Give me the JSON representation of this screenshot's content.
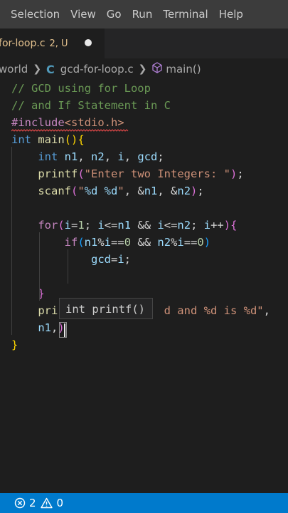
{
  "menu": [
    "Selection",
    "View",
    "Go",
    "Run",
    "Terminal",
    "Help"
  ],
  "tab": {
    "title": "-for-loop.c",
    "status": "2, U"
  },
  "breadcrumb": {
    "folder": "world",
    "file_icon": "C",
    "file": "gcd-for-loop.c",
    "symbol": "main()"
  },
  "code": [
    [
      [
        "// GCD using for Loop",
        "c-cmt"
      ]
    ],
    [
      [
        "// and If Statement in C",
        "c-cmt"
      ]
    ],
    [
      [
        "#include",
        "c-inc"
      ],
      [
        "<stdio.h>",
        "c-str"
      ]
    ],
    [
      [
        "int",
        "c-kw"
      ],
      [
        " ",
        ""
      ],
      [
        "main",
        "c-fn"
      ],
      [
        "(){",
        "c-br1"
      ]
    ],
    [
      [
        "    ",
        ""
      ],
      [
        "int",
        "c-kw"
      ],
      [
        " ",
        ""
      ],
      [
        "n1",
        "c-var"
      ],
      [
        ", ",
        ""
      ],
      [
        "n2",
        "c-var"
      ],
      [
        ", ",
        ""
      ],
      [
        "i",
        "c-var"
      ],
      [
        ", ",
        ""
      ],
      [
        "gcd",
        "c-var"
      ],
      [
        ";",
        ""
      ]
    ],
    [
      [
        "    ",
        ""
      ],
      [
        "printf",
        "c-fn"
      ],
      [
        "(",
        "c-br2"
      ],
      [
        "\"Enter two Integers: \"",
        "c-str"
      ],
      [
        ")",
        "c-br2"
      ],
      [
        ";",
        ""
      ]
    ],
    [
      [
        "    ",
        ""
      ],
      [
        "scanf",
        "c-fn"
      ],
      [
        "(",
        "c-br2"
      ],
      [
        "\"",
        "c-str"
      ],
      [
        "%d %d",
        "c-var"
      ],
      [
        "\"",
        "c-str"
      ],
      [
        ", &",
        ""
      ],
      [
        "n1",
        "c-var"
      ],
      [
        ", &",
        ""
      ],
      [
        "n2",
        "c-var"
      ],
      [
        ")",
        "c-br2"
      ],
      [
        ";",
        ""
      ]
    ],
    [],
    [
      [
        "    ",
        ""
      ],
      [
        "for",
        "c-ctl"
      ],
      [
        "(",
        "c-br2"
      ],
      [
        "i",
        "c-var"
      ],
      [
        "=",
        ""
      ],
      [
        "1",
        "c-num"
      ],
      [
        "; ",
        ""
      ],
      [
        "i",
        "c-var"
      ],
      [
        "<=",
        ""
      ],
      [
        "n1",
        "c-var"
      ],
      [
        " && ",
        ""
      ],
      [
        "i",
        "c-var"
      ],
      [
        "<=",
        ""
      ],
      [
        "n2",
        "c-var"
      ],
      [
        "; ",
        ""
      ],
      [
        "i",
        "c-var"
      ],
      [
        "++",
        ""
      ],
      [
        "){",
        "c-br2"
      ]
    ],
    [
      [
        "        ",
        ""
      ],
      [
        "if",
        "c-ctl"
      ],
      [
        "(",
        "c-br3"
      ],
      [
        "n1",
        "c-var"
      ],
      [
        "%",
        ""
      ],
      [
        "i",
        "c-var"
      ],
      [
        "==",
        ""
      ],
      [
        "0",
        "c-num"
      ],
      [
        " && ",
        ""
      ],
      [
        "n2",
        "c-var"
      ],
      [
        "%",
        ""
      ],
      [
        "i",
        "c-var"
      ],
      [
        "==",
        ""
      ],
      [
        "0",
        "c-num"
      ],
      [
        ")",
        "c-br3"
      ]
    ],
    [
      [
        "            ",
        ""
      ],
      [
        "gcd",
        "c-var"
      ],
      [
        "=",
        ""
      ],
      [
        "i",
        "c-var"
      ],
      [
        ";",
        ""
      ]
    ],
    [],
    [
      [
        "    ",
        ""
      ],
      [
        "}",
        "c-br2"
      ]
    ],
    [
      [
        "    ",
        ""
      ],
      [
        "pri",
        "c-fn"
      ],
      [
        "                d and %d is %d\"",
        "c-str"
      ],
      [
        ",",
        ""
      ]
    ],
    [
      [
        "    ",
        ""
      ],
      [
        "n1",
        "c-var"
      ],
      [
        ",",
        ""
      ],
      [
        ")",
        "c-br2"
      ]
    ],
    [
      [
        "}",
        "c-br1"
      ]
    ]
  ],
  "hover": "int printf()",
  "status": {
    "errors": "2",
    "warnings": "0"
  }
}
